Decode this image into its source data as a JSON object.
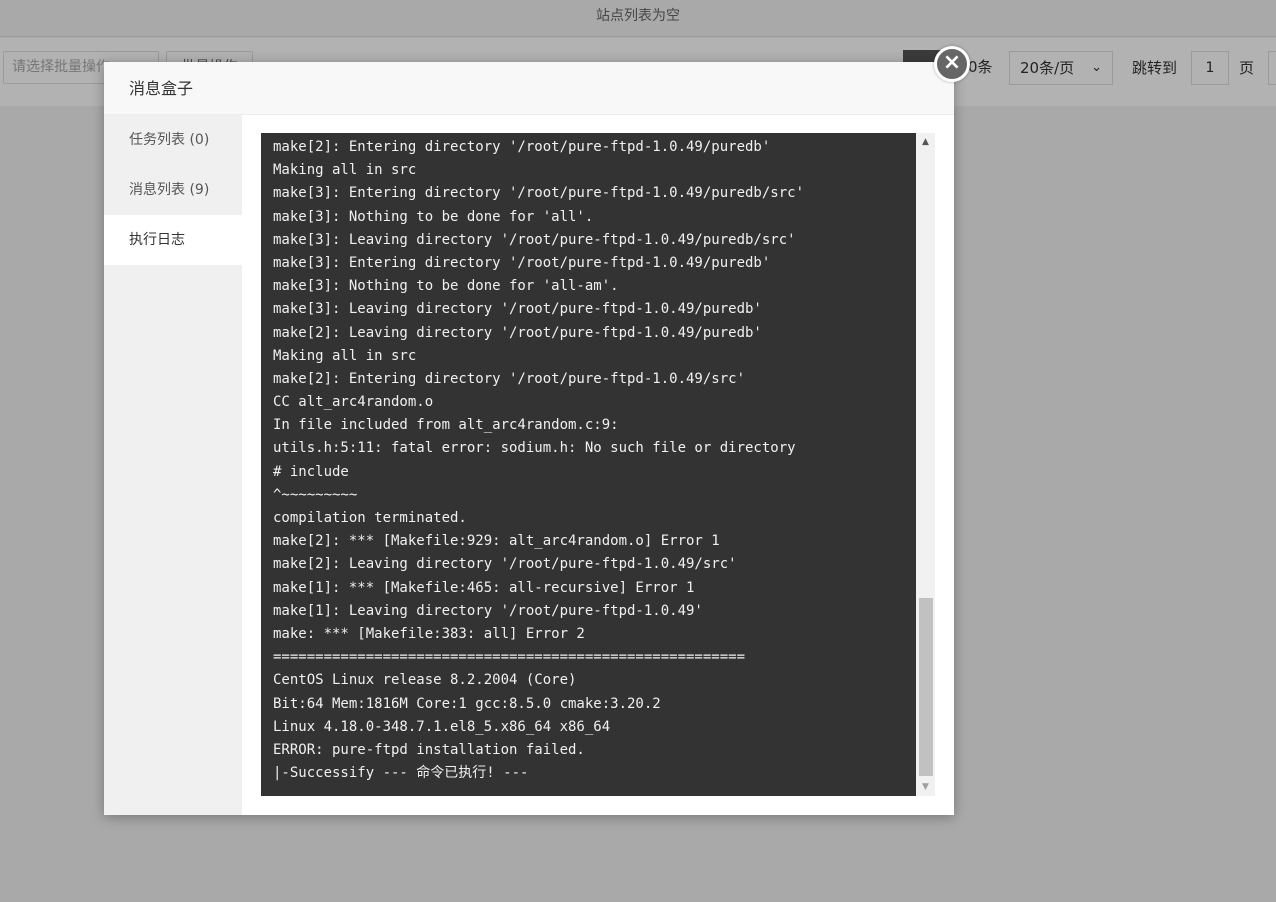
{
  "page": {
    "title": "站点列表为空",
    "batch_placeholder": "请选择批量操作",
    "batch_button": "批量操作",
    "total_text": "0条",
    "page_size": "20条/页",
    "jump_label": "跳转到",
    "page_number": "1",
    "page_unit": "页"
  },
  "modal": {
    "title": "消息盒子",
    "sidebar": [
      {
        "label": "任务列表 (0)",
        "active": false
      },
      {
        "label": "消息列表 (9)",
        "active": false
      },
      {
        "label": "执行日志",
        "active": true
      }
    ],
    "console_lines": [
      "make[2]: Entering directory '/root/pure-ftpd-1.0.49/puredb'",
      "Making all in src",
      "make[3]: Entering directory '/root/pure-ftpd-1.0.49/puredb/src'",
      "make[3]: Nothing to be done for 'all'.",
      "make[3]: Leaving directory '/root/pure-ftpd-1.0.49/puredb/src'",
      "make[3]: Entering directory '/root/pure-ftpd-1.0.49/puredb'",
      "make[3]: Nothing to be done for 'all-am'.",
      "make[3]: Leaving directory '/root/pure-ftpd-1.0.49/puredb'",
      "make[2]: Leaving directory '/root/pure-ftpd-1.0.49/puredb'",
      "Making all in src",
      "make[2]: Entering directory '/root/pure-ftpd-1.0.49/src'",
      "CC alt_arc4random.o",
      "In file included from alt_arc4random.c:9:",
      "utils.h:5:11: fatal error: sodium.h: No such file or directory",
      "# include",
      "^~~~~~~~~~",
      "compilation terminated.",
      "make[2]: *** [Makefile:929: alt_arc4random.o] Error 1",
      "make[2]: Leaving directory '/root/pure-ftpd-1.0.49/src'",
      "make[1]: *** [Makefile:465: all-recursive] Error 1",
      "make[1]: Leaving directory '/root/pure-ftpd-1.0.49'",
      "make: *** [Makefile:383: all] Error 2",
      "========================================================",
      "CentOS Linux release 8.2.2004 (Core)",
      "Bit:64 Mem:1816M Core:1 gcc:8.5.0 cmake:3.20.2",
      "Linux 4.18.0-348.7.1.el8_5.x86_64 x86_64",
      "ERROR: pure-ftpd installation failed.",
      "|-Successify --- 命令已执行! ---"
    ]
  },
  "icons": {
    "close": "close-icon",
    "scroll_up": "scroll-up-arrow-icon",
    "scroll_down": "scroll-down-arrow-icon",
    "select_chevron": "chevron-down-icon"
  },
  "colors": {
    "console_bg": "#333333",
    "console_text": "#f0f0f0",
    "sidebar_bg": "#f0f0f0",
    "close_bg": "#666666"
  }
}
